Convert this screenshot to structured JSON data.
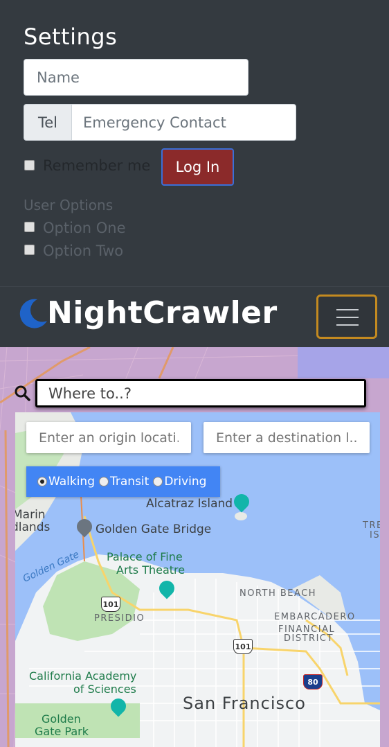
{
  "settings": {
    "title": "Settings",
    "name_placeholder": "Name",
    "tel_prefix": "Tel",
    "contact_placeholder": "Emergency Contact",
    "remember_label": "Remember me",
    "login_label": "Log In",
    "user_options_heading": "User Options",
    "options": [
      "Option One",
      "Option Two"
    ]
  },
  "navbar": {
    "brand": "NightCrawler",
    "logo_icon": "moon-icon",
    "menu_icon": "hamburger-menu-icon"
  },
  "search": {
    "placeholder": "Where to..?",
    "icon": "search-icon"
  },
  "map": {
    "origin_placeholder": "Enter an origin locati...",
    "destination_placeholder": "Enter a destination l...",
    "travel_modes": [
      "Walking",
      "Transit",
      "Driving"
    ],
    "selected_mode": "Walking",
    "labels": {
      "alcatraz": "Alcatraz Island",
      "marin_1": "Marin",
      "marin_2": "dlands",
      "golden_gate_bridge": "Golden Gate Bridge",
      "golden_gate_water": "Golden Gate",
      "palace_1": "Palace of Fine",
      "palace_2": "Arts Theatre",
      "north_beach": "NORTH BEACH",
      "presidio": "PRESIDIO",
      "embarcadero_1": "EMBARCADERO",
      "embarcadero_2": "FINANCIAL",
      "embarcadero_3": "DISTRICT",
      "academy_1": "California Academy",
      "academy_2": "of Sciences",
      "san_francisco": "San Francisco",
      "golden_gate_park_1": "Golden",
      "golden_gate_park_2": "Gate Park",
      "treasure_1": "TRE",
      "treasure_2": "IS",
      "route_101": "101",
      "route_80": "80"
    },
    "colors": {
      "water": "#9cc0f9",
      "land": "#f1f3f4",
      "park": "#bfe3b4",
      "highway": "#f8d46b",
      "mode_box": "#4285f4"
    }
  },
  "colors": {
    "panel_bg": "#343a40",
    "login_button": "#8b2a2a",
    "toggler_border": "#c48a20",
    "outer_map_tint": "#b6a3cf"
  }
}
